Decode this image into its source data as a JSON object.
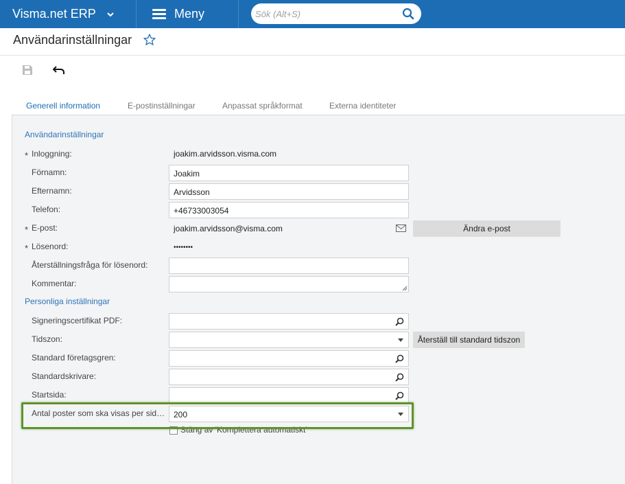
{
  "app": {
    "title": "Visma.net ERP",
    "menu_label": "Meny"
  },
  "search": {
    "placeholder": "Sök (Alt+S)"
  },
  "page": {
    "title": "Användarinställningar"
  },
  "tabs": [
    {
      "label": "Generell information",
      "active": true
    },
    {
      "label": "E-postinställningar",
      "active": false
    },
    {
      "label": "Anpassat språkformat",
      "active": false
    },
    {
      "label": "Externa identiteter",
      "active": false
    }
  ],
  "sections": {
    "user_settings": "Användarinställningar",
    "personal_settings": "Personliga inställningar"
  },
  "fields": {
    "login": {
      "label": "Inloggning:",
      "value": "joakim.arvidsson.visma.com"
    },
    "firstname": {
      "label": "Förnamn:",
      "value": "Joakim"
    },
    "lastname": {
      "label": "Efternamn:",
      "value": "Arvidsson"
    },
    "phone": {
      "label": "Telefon:",
      "value": "+46733003054"
    },
    "email": {
      "label": "E-post:",
      "value": "joakim.arvidsson@visma.com"
    },
    "password": {
      "label": "Lösenord:",
      "value": "••••••••"
    },
    "reset_question": {
      "label": "Återställningsfråga för lösenord:",
      "value": ""
    },
    "comment": {
      "label": "Kommentar:",
      "value": ""
    },
    "pdf_cert": {
      "label": "Signeringscertifikat PDF:",
      "value": ""
    },
    "timezone": {
      "label": "Tidszon:",
      "value": ""
    },
    "default_branch": {
      "label": "Standard företagsgren:",
      "value": ""
    },
    "default_printer": {
      "label": "Standardskrivare:",
      "value": ""
    },
    "start_page": {
      "label": "Startsida:",
      "value": ""
    },
    "rows_per_page": {
      "label": "Antal poster som ska visas per sid…",
      "value": "200"
    }
  },
  "buttons": {
    "change_email": "Ändra e-post",
    "reset_timezone": "Återställ till standard tidszon"
  },
  "checkbox": {
    "label": "Stäng av 'Komplettera automatiskt'",
    "checked": false
  },
  "required_marker": "*",
  "colors": {
    "topbar": "#1c6db3",
    "accent": "#2e75b6",
    "highlight": "#5e9428"
  }
}
